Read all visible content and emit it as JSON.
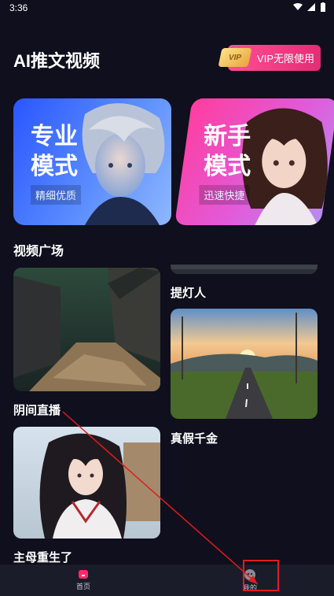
{
  "status_bar": {
    "time": "3:36"
  },
  "header": {
    "title": "AI推文视频",
    "vip_badge": "VIP",
    "vip_label": "VIP无限使用"
  },
  "modes": [
    {
      "title_line1": "专业",
      "title_line2": "模式",
      "subtitle": "精细优质"
    },
    {
      "title_line1": "新手",
      "title_line2": "模式",
      "subtitle": "迅速快捷"
    }
  ],
  "section": {
    "title": "视频广场"
  },
  "videos": [
    {
      "title": "提灯人"
    },
    {
      "title": "阴间直播"
    },
    {
      "title": "真假千金"
    },
    {
      "title": "主母重生了"
    }
  ],
  "nav": {
    "items": [
      {
        "label": "首页",
        "icon": "home-icon"
      },
      {
        "label": "我的",
        "icon": "profile-icon"
      }
    ]
  },
  "colors": {
    "background": "#0f0f1d",
    "vip_gradient_start": "#ff4f93",
    "pro_card": "#2a56ff",
    "newbie_card": "#ff3d9d",
    "nav_active": "#ff2a6a",
    "annotation_red": "#e11c1c"
  }
}
